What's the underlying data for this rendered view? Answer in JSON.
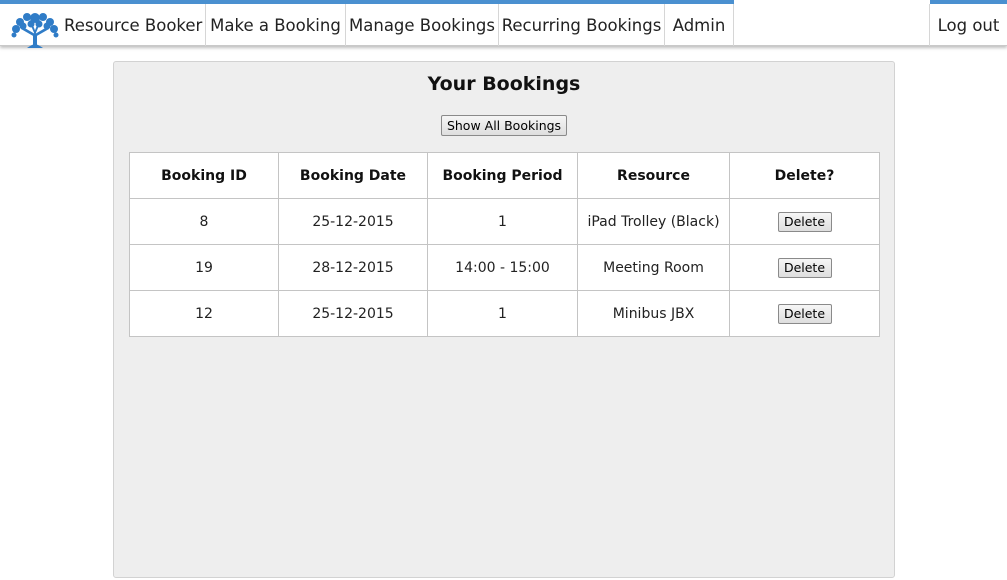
{
  "nav": {
    "brand": "Resource Booker",
    "items": [
      {
        "label": "Make a Booking"
      },
      {
        "label": "Manage Bookings"
      },
      {
        "label": "Recurring Bookings"
      },
      {
        "label": "Admin"
      }
    ],
    "logout": "Log out",
    "accent_color": "#4a90d0"
  },
  "main": {
    "title": "Your Bookings",
    "show_all_label": "Show All Bookings",
    "table": {
      "headers": [
        "Booking ID",
        "Booking Date",
        "Booking Period",
        "Resource",
        "Delete?"
      ],
      "rows": [
        {
          "id": "8",
          "date": "25-12-2015",
          "period": "1",
          "resource": "iPad Trolley (Black)",
          "delete_label": "Delete"
        },
        {
          "id": "19",
          "date": "28-12-2015",
          "period": "14:00 - 15:00",
          "resource": "Meeting Room",
          "delete_label": "Delete"
        },
        {
          "id": "12",
          "date": "25-12-2015",
          "period": "1",
          "resource": "Minibus JBX",
          "delete_label": "Delete"
        }
      ]
    }
  },
  "icons": {
    "brand": "tree-icon"
  }
}
